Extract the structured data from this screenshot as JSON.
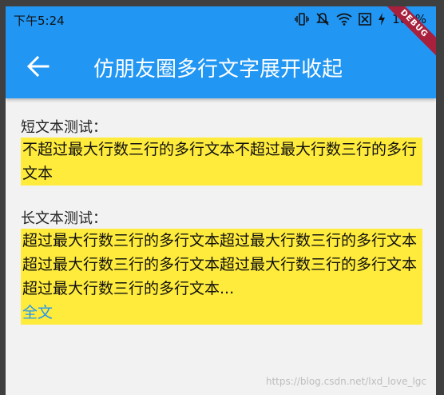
{
  "status_bar": {
    "time": "下午5:24",
    "battery": "100%",
    "icons": [
      "vibrate-icon",
      "mute-icon",
      "wifi-icon",
      "no-sim-icon",
      "charging-icon"
    ]
  },
  "debug_banner": "DEBUG",
  "app_bar": {
    "back_icon": "arrow-back-icon",
    "title": "仿朋友圈多行文字展开收起",
    "color": "#2196f3"
  },
  "sections": [
    {
      "label": "短文本测试：",
      "text": "不超过最大行数三行的多行文本不超过最大行数三行的多行文本"
    },
    {
      "label": "长文本测试：",
      "text": "超过最大行数三行的多行文本超过最大行数三行的多行文本超过最大行数三行的多行文本超过最大行数三行的多行文本超过最大行数三行的多行文本...",
      "expand_label": "全文"
    }
  ],
  "highlight_color": "#ffeb3b",
  "watermark": "https://blog.csdn.net/lxd_love_lgc"
}
